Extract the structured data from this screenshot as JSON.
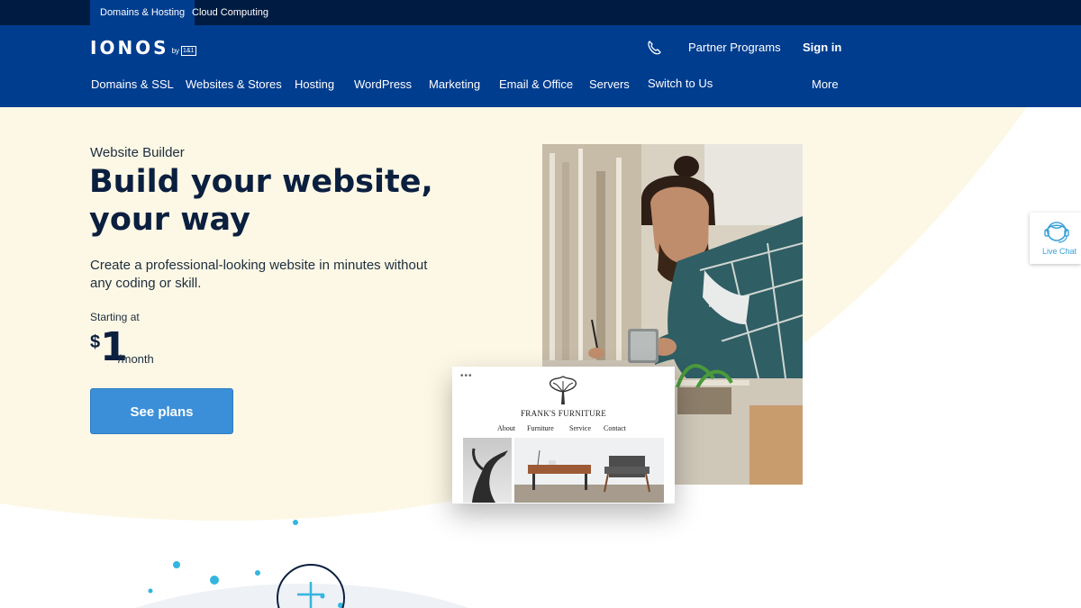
{
  "top_tabs": [
    {
      "label": "Domains & Hosting",
      "active": true
    },
    {
      "label": "Cloud Computing",
      "active": false
    }
  ],
  "header": {
    "logo_text": "IONOS",
    "logo_by": "by",
    "logo_badge": "1&1",
    "phone_icon": "phone-icon",
    "partner_label": "Partner Programs",
    "signin_label": "Sign in"
  },
  "nav": [
    "Domains & SSL",
    "Websites & Stores",
    "Hosting",
    "WordPress",
    "Marketing",
    "Email & Office",
    "Servers",
    "Switch to Us",
    "More"
  ],
  "hero": {
    "eyebrow": "Website Builder",
    "headline": "Build your website, your way",
    "subtext": "Create a professional-looking website in minutes without any coding or skill.",
    "starting_label": "Starting at",
    "currency": "$",
    "price": "1",
    "per": "/month",
    "cta_label": "See plans"
  },
  "preview": {
    "dots": "•••",
    "brand": "FRANK'S FURNITURE",
    "nav": [
      "About",
      "Furniture",
      "Service",
      "Contact"
    ]
  },
  "live_chat": {
    "label": "Live Chat",
    "icon": "headset-agent-icon"
  },
  "colors": {
    "top_strip": "#001b41",
    "header": "#003d8f",
    "hero_bg": "#fdf8e6",
    "cta": "#3b8fd9",
    "headline": "#0b1f3f",
    "accent_dot": "#33b5e0"
  }
}
